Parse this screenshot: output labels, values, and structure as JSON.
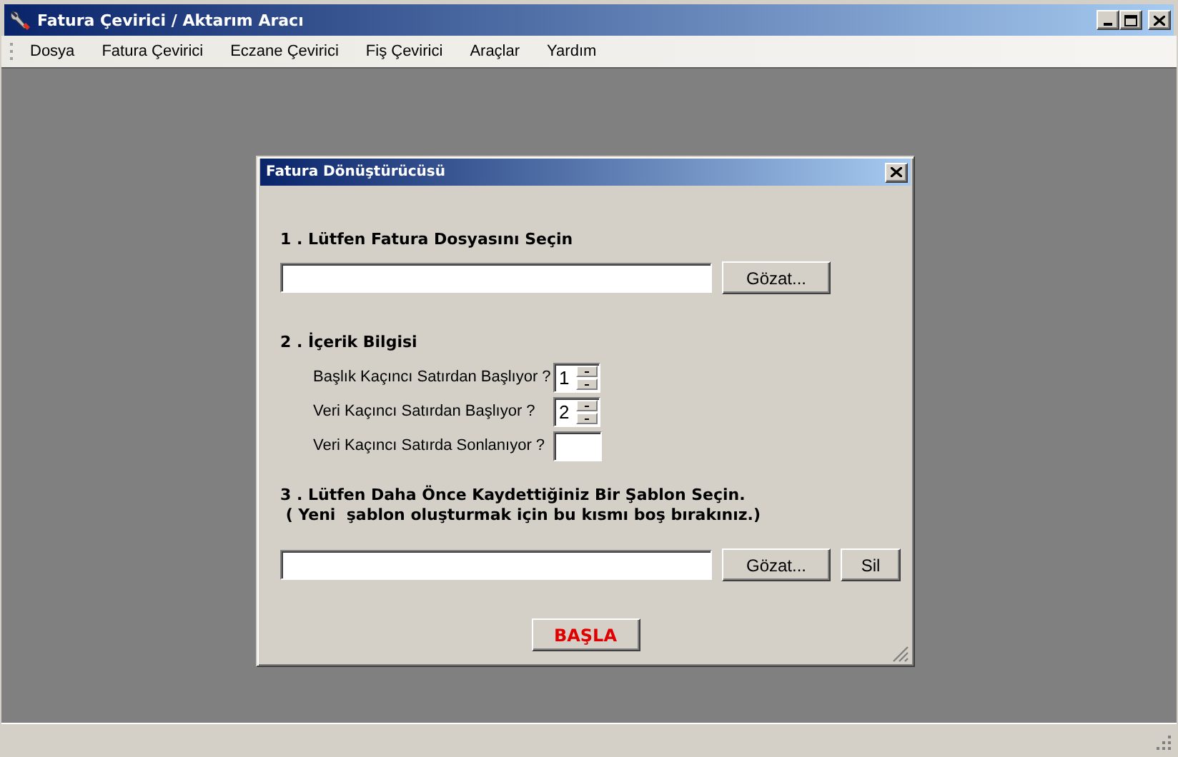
{
  "window": {
    "title": "Fatura Çevirici / Aktarım Aracı"
  },
  "menu": [
    {
      "label": "Dosya"
    },
    {
      "label": "Fatura Çevirici"
    },
    {
      "label": "Eczane Çevirici"
    },
    {
      "label": "Fiş Çevirici"
    },
    {
      "label": "Araçlar"
    },
    {
      "label": "Yardım"
    }
  ],
  "dialog": {
    "title": "Fatura Dönüştürücüsü",
    "section_1": {
      "heading": "1 . Lütfen Fatura Dosyasını Seçin",
      "browse_button": "Gözat..."
    },
    "section_2": {
      "heading": "2 . İçerik Bilgisi",
      "rows": [
        {
          "label": "Başlık Kaçıncı Satırdan Başlıyor ?",
          "kind": "spinner",
          "value": "1"
        },
        {
          "label": "Veri Kaçıncı Satırdan Başlıyor ?",
          "kind": "spinner",
          "value": "2"
        },
        {
          "label": "Veri Kaçıncı Satırda Sonlanıyor ?",
          "kind": "field"
        }
      ]
    },
    "section_3": {
      "heading": "3 . Lütfen Daha Önce Kaydettiğiniz Bir Şablon Seçin.",
      "note": " ( Yeni  şablon oluşturmak için bu kısmı boş bırakınız.)",
      "browse_button": "Gözat...",
      "delete_button": "Sil"
    },
    "start_button": "BAŞLA"
  }
}
